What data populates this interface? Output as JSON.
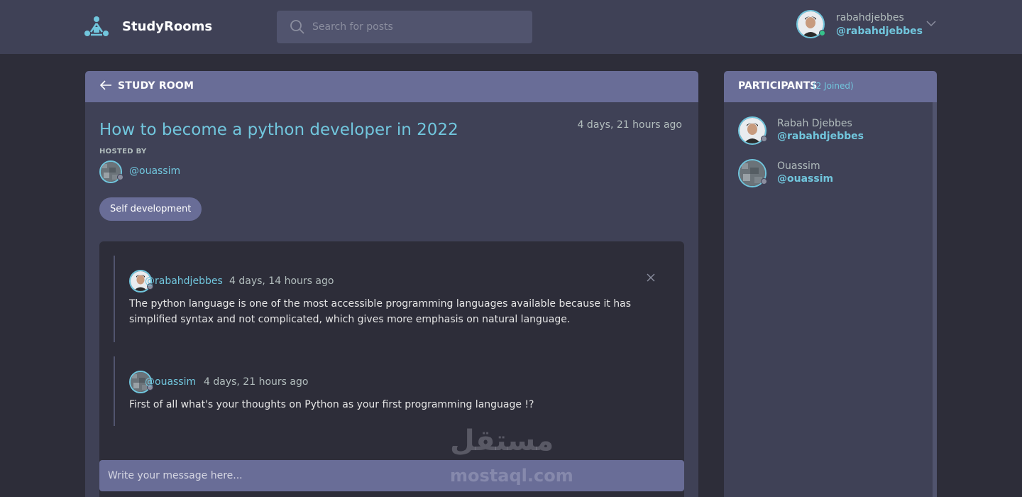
{
  "header": {
    "brand": "StudyRooms",
    "search_placeholder": "Search for posts",
    "user": {
      "name": "rabahdjebbes",
      "handle": "@rabahdjebbes"
    }
  },
  "room": {
    "header_label": "STUDY ROOM",
    "title": "How to become a python developer in 2022",
    "created": "4 days, 21 hours ago",
    "hosted_by_label": "HOSTED BY",
    "host_handle": "@ouassim",
    "topic": "Self development",
    "messages": [
      {
        "handle": "@rabahdjebbes",
        "time": "4 days, 14 hours ago",
        "text": "The python language is one of the most accessible programming languages available because it has simplified syntax and not complicated, which gives more emphasis on natural language."
      },
      {
        "handle": "@ouassim",
        "time": "4 days, 21 hours ago",
        "text": "First of all what's your thoughts on Python as your first programming language !?"
      }
    ],
    "composer_placeholder": "Write your message here..."
  },
  "participants": {
    "title": "PARTICIPANTS",
    "count": "(2 Joined)",
    "list": [
      {
        "name": "Rabah Djebbes",
        "handle": "@rabahdjebbes"
      },
      {
        "name": "Ouassim",
        "handle": "@ouassim"
      }
    ]
  },
  "watermark": {
    "arabic": "مستقل",
    "latin": "mostaql.com"
  },
  "colors": {
    "background": "#2d2d39",
    "panel": "#3f4156",
    "accent": "#696d97",
    "link": "#71c6dd",
    "online": "#36c28b",
    "offline": "#8b8e9f"
  },
  "icons": [
    "rooms-logo-icon",
    "search-icon",
    "chevron-down-icon",
    "arrow-left-icon",
    "close-icon"
  ]
}
